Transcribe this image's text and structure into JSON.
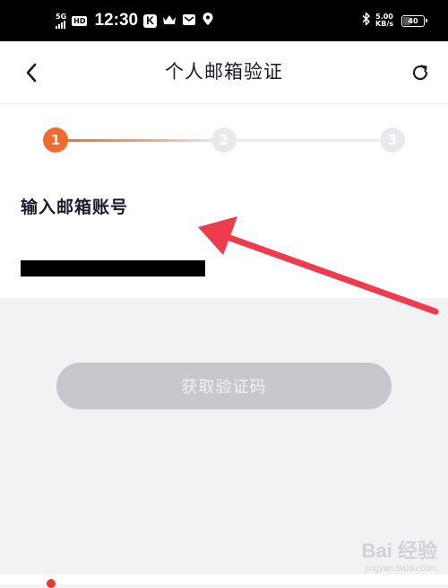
{
  "status_bar": {
    "network": "5G",
    "hd_badge": "HD",
    "time": "12:30",
    "k_badge": "K",
    "speed_value": "5.00",
    "speed_unit": "KB/s",
    "battery_level": "40",
    "battery_fraction": 0.4
  },
  "nav": {
    "title": "个人邮箱验证",
    "back_icon": "chevron-left-icon",
    "refresh_icon": "refresh-icon"
  },
  "stepper": {
    "steps": [
      "1",
      "2",
      "3"
    ],
    "current_step": 1,
    "active_color": "#f26a2e",
    "inactive_color": "#e9e9ed"
  },
  "form": {
    "label": "输入邮箱账号",
    "email_value": "",
    "email_placeholder": ""
  },
  "actions": {
    "get_code_label": "获取验证码",
    "disabled_color": "#c7c7cd"
  },
  "annotation": {
    "arrow_color": "#ef3b4e"
  },
  "watermark": {
    "main_text": "Bai 经验",
    "sub_text": "jingyan.baidu.com"
  }
}
